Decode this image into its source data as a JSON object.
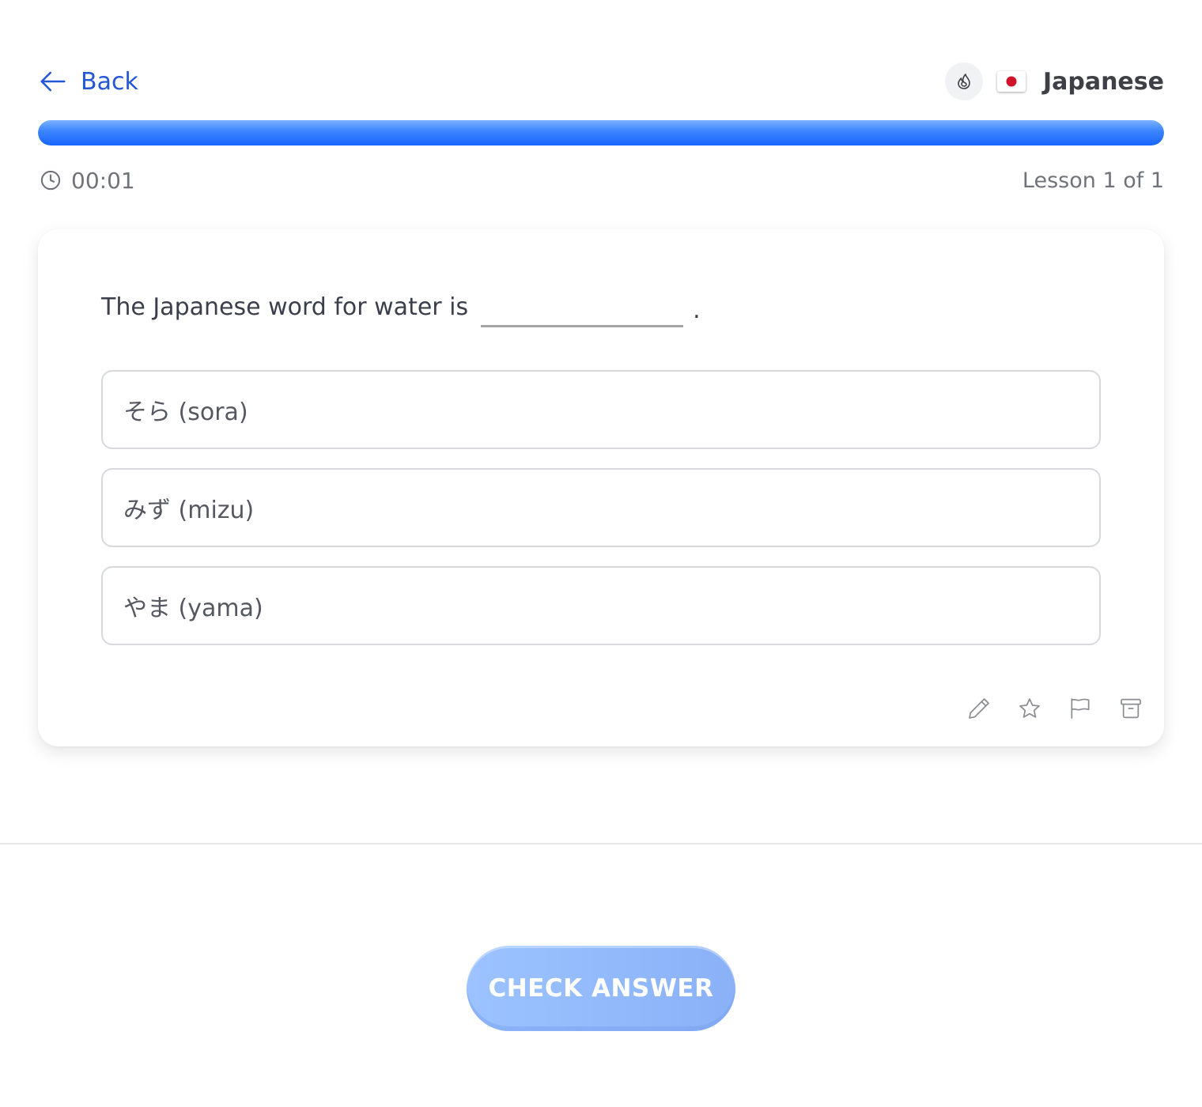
{
  "header": {
    "back_label": "Back",
    "language_name": "Japanese",
    "flag_icon": "japan-flag-icon",
    "streak_icon": "flame-icon"
  },
  "progress": {
    "fraction": 1.0,
    "fill_color": "#1765ff"
  },
  "status": {
    "timer": "00:01",
    "lesson_count": "Lesson 1 of 1"
  },
  "question": {
    "prompt": "The Japanese word for water is",
    "end_mark": "."
  },
  "options": [
    {
      "label": "そら (sora)"
    },
    {
      "label": "みず (mizu)"
    },
    {
      "label": "やま (yama)"
    }
  ],
  "tools": [
    "edit-icon",
    "star-icon",
    "flag-icon",
    "archive-icon"
  ],
  "footer": {
    "check_label": "CHECK ANSWER"
  },
  "colors": {
    "accent": "#2457d6",
    "button": "#9cc3ff"
  }
}
